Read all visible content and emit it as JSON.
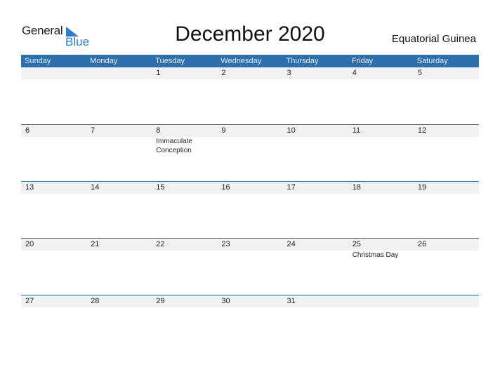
{
  "logo": {
    "text_general": "General",
    "text_blue": "Blue",
    "brand_color": "#2a7fcf"
  },
  "title": "December 2020",
  "country": "Equatorial Guinea",
  "header_color": "#2e6fae",
  "weekdays": [
    "Sunday",
    "Monday",
    "Tuesday",
    "Wednesday",
    "Thursday",
    "Friday",
    "Saturday"
  ],
  "weeks": [
    [
      {
        "day": ""
      },
      {
        "day": ""
      },
      {
        "day": "1"
      },
      {
        "day": "2"
      },
      {
        "day": "3"
      },
      {
        "day": "4"
      },
      {
        "day": "5"
      }
    ],
    [
      {
        "day": "6"
      },
      {
        "day": "7"
      },
      {
        "day": "8",
        "holiday": "Immaculate Conception"
      },
      {
        "day": "9"
      },
      {
        "day": "10"
      },
      {
        "day": "11"
      },
      {
        "day": "12"
      }
    ],
    [
      {
        "day": "13"
      },
      {
        "day": "14"
      },
      {
        "day": "15"
      },
      {
        "day": "16"
      },
      {
        "day": "17"
      },
      {
        "day": "18"
      },
      {
        "day": "19"
      }
    ],
    [
      {
        "day": "20"
      },
      {
        "day": "21"
      },
      {
        "day": "22"
      },
      {
        "day": "23"
      },
      {
        "day": "24"
      },
      {
        "day": "25",
        "holiday": "Christmas Day"
      },
      {
        "day": "26"
      }
    ],
    [
      {
        "day": "27"
      },
      {
        "day": "28"
      },
      {
        "day": "29"
      },
      {
        "day": "30"
      },
      {
        "day": "31"
      },
      {
        "day": ""
      },
      {
        "day": ""
      }
    ]
  ]
}
